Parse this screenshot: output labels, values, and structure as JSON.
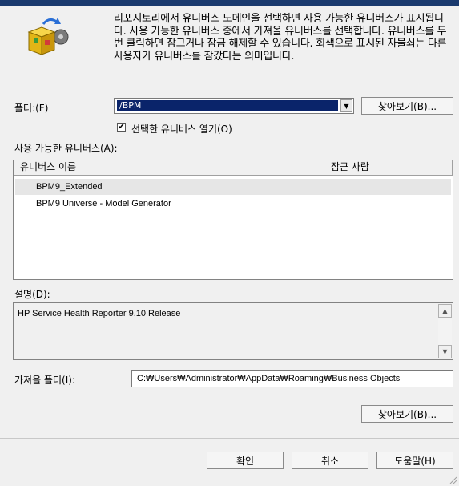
{
  "description": "리포지토리에서 유니버스 도메인을 선택하면 사용 가능한 유니버스가 표시됩니다. 사용 가능한 유니버스 중에서 가져올 유니버스를 선택합니다. 유니버스를 두 번 클릭하면 잠그거나 잠금 해제할 수 있습니다. 회색으로 표시된 자물쇠는 다른 사용자가 유니버스를 잠갔다는 의미입니다.",
  "folder": {
    "label": "폴더:(F)",
    "value": "/BPM",
    "browse_label": "찾아보기(B)..."
  },
  "open_selected": {
    "checked": true,
    "check_mark": "✔",
    "label": "선택한 유니버스 열기(O)"
  },
  "available": {
    "label": "사용 가능한 유니버스(A):",
    "columns": [
      "유니버스 이름",
      "잠근 사람"
    ],
    "rows": [
      {
        "name": "BPM9_Extended",
        "locked_by": "",
        "selected": true
      },
      {
        "name": "BPM9 Universe - Model Generator",
        "locked_by": "",
        "selected": false
      }
    ]
  },
  "explanation": {
    "label": "설명(D):",
    "text": "HP Service Health Reporter 9.10 Release"
  },
  "import_folder": {
    "label": "가져올 폴더(I):",
    "value": "C:₩Users₩Administrator₩AppData₩Roaming₩Business Objects",
    "browse_label": "찾아보기(B)..."
  },
  "buttons": {
    "ok": "확인",
    "cancel": "취소",
    "help": "도움말(H)"
  },
  "colors": {
    "selection": "#0a246a",
    "dialog_bg": "#f0f0f0"
  },
  "icons": [
    "import-wizard-icon",
    "chevron-down-icon",
    "scroll-up-icon",
    "scroll-down-icon"
  ]
}
